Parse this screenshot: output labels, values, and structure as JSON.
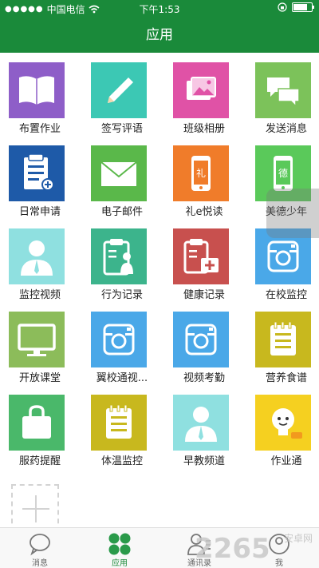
{
  "status": {
    "carrier": "中国电信",
    "time": "下午1:53"
  },
  "header": {
    "title": "应用"
  },
  "apps": [
    {
      "label": "布置作业",
      "icon": "book-icon",
      "color": "#8e5ec8"
    },
    {
      "label": "签写评语",
      "icon": "pencil-icon",
      "color": "#3cc8b4"
    },
    {
      "label": "班级相册",
      "icon": "photo-album-icon",
      "color": "#e052a6"
    },
    {
      "label": "发送消息",
      "icon": "chat-bubbles-icon",
      "color": "#7cc25a"
    },
    {
      "label": "日常申请",
      "icon": "application-form-icon",
      "color": "#1e5aa8"
    },
    {
      "label": "电子邮件",
      "icon": "envelope-icon",
      "color": "#5ab84a"
    },
    {
      "label": "礼e悦读",
      "icon": "phone-reading-icon",
      "color": "#f07c2a"
    },
    {
      "label": "美德少年",
      "icon": "phone-virtue-icon",
      "color": "#5ac95a"
    },
    {
      "label": "监控视频",
      "icon": "person-icon",
      "color": "#8fe0e0"
    },
    {
      "label": "行为记录",
      "icon": "clipboard-person-icon",
      "color": "#3cb48c"
    },
    {
      "label": "健康记录",
      "icon": "clipboard-medkit-icon",
      "color": "#c8504e"
    },
    {
      "label": "在校监控",
      "icon": "camera-icon",
      "color": "#4aa8e8"
    },
    {
      "label": "开放课堂",
      "icon": "monitor-icon",
      "color": "#8cbc5a"
    },
    {
      "label": "翼校通视...",
      "icon": "camera-icon",
      "color": "#4aa8e8"
    },
    {
      "label": "视频考勤",
      "icon": "camera-icon",
      "color": "#4aa8e8"
    },
    {
      "label": "营养食谱",
      "icon": "notepad-icon",
      "color": "#c8b81e"
    },
    {
      "label": "服药提醒",
      "icon": "bag-icon",
      "color": "#4ab86a"
    },
    {
      "label": "体温监控",
      "icon": "notepad-icon",
      "color": "#c8b81e"
    },
    {
      "label": "早教频道",
      "icon": "person-icon",
      "color": "#8fe0e0"
    },
    {
      "label": "作业通",
      "icon": "lightbulb-icon",
      "color": "#f5d020"
    }
  ],
  "tabs": [
    {
      "label": "消息",
      "icon": "chat-icon",
      "active": false
    },
    {
      "label": "应用",
      "icon": "apps-grid-icon",
      "active": true
    },
    {
      "label": "通讯录",
      "icon": "contacts-icon",
      "active": false
    },
    {
      "label": "我",
      "icon": "profile-icon",
      "active": false
    }
  ],
  "watermark": {
    "main": "2265",
    "sub": "安卓网"
  },
  "colors": {
    "brand": "#1a8a3a"
  }
}
